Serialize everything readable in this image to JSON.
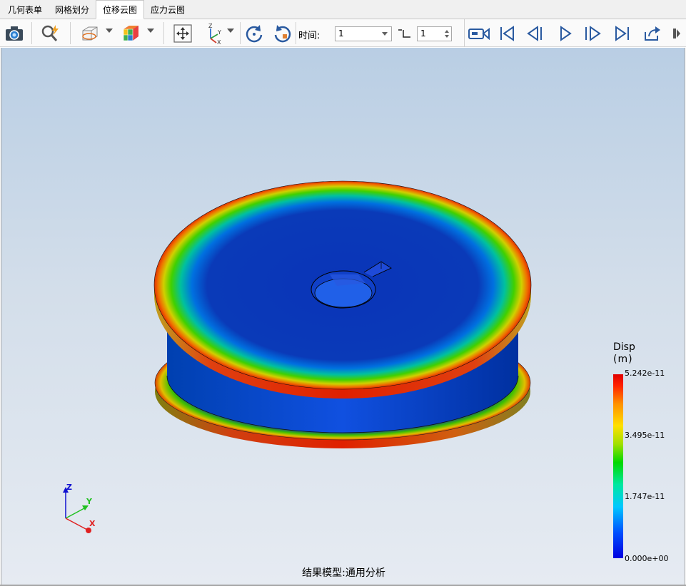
{
  "tabs": [
    {
      "label": "几何表单",
      "active": false
    },
    {
      "label": "网格划分",
      "active": false
    },
    {
      "label": "位移云图",
      "active": true
    },
    {
      "label": "应力云图",
      "active": false
    }
  ],
  "toolbar": {
    "time_label": "时间:",
    "time_value": "1",
    "step_value": "1",
    "icons": [
      "camera-icon",
      "zoom-lightning-icon",
      "section-view-icon",
      "display-style-icon",
      "fit-view-icon",
      "axes-orientation-icon",
      "rotate-ccw-icon",
      "rotate-cw-icon"
    ],
    "player_icons": [
      "record-video-icon",
      "first-frame-icon",
      "prev-frame-icon",
      "play-icon",
      "next-frame-icon",
      "last-frame-icon",
      "export-icon",
      "more-icon"
    ]
  },
  "legend": {
    "title": "Disp",
    "unit": "(m)",
    "max": "5.242e-11",
    "v2": "3.495e-11",
    "v1": "1.747e-11",
    "min": "0.000e+00",
    "colors": {
      "max": "#e00000",
      "mid": "#00d800",
      "min": "#0000e0"
    }
  },
  "triad": {
    "z": "Z",
    "y": "Y",
    "x": "X"
  },
  "caption": "结果模型:通用分析"
}
